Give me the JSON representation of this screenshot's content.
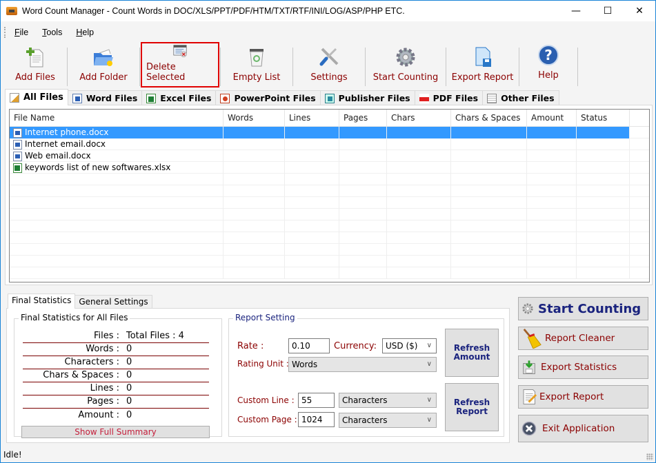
{
  "window": {
    "title": "Word Count Manager - Count Words in DOC/XLS/PPT/PDF/HTM/TXT/RTF/INI/LOG/ASP/PHP ETC.",
    "minimize": "—",
    "maximize": "☐",
    "close": "✕"
  },
  "menu": [
    {
      "accel": "F",
      "rest": "ile"
    },
    {
      "accel": "T",
      "rest": "ools"
    },
    {
      "accel": "H",
      "rest": "elp"
    }
  ],
  "toolbar": [
    {
      "label": "Add Files",
      "icon": "add-files-icon"
    },
    {
      "label": "Add Folder",
      "icon": "add-folder-icon"
    },
    {
      "label": "Delete Selected",
      "icon": "delete-selected-icon",
      "highlighted": true
    },
    {
      "label": "Empty List",
      "icon": "recycle-bin-icon"
    },
    {
      "label": "Settings",
      "icon": "settings-tools-icon"
    },
    {
      "label": "Start Counting",
      "icon": "gear-icon"
    },
    {
      "label": "Export Report",
      "icon": "export-report-icon"
    },
    {
      "label": "Help",
      "icon": "help-icon"
    }
  ],
  "file_tabs": [
    {
      "label": "All Files",
      "active": true
    },
    {
      "label": "Word Files"
    },
    {
      "label": "Excel Files"
    },
    {
      "label": "PowerPoint Files"
    },
    {
      "label": "Publisher Files"
    },
    {
      "label": "PDF Files"
    },
    {
      "label": "Other Files"
    }
  ],
  "table": {
    "columns": [
      "File Name",
      "Words",
      "Lines",
      "Pages",
      "Chars",
      "Chars & Spaces",
      "Amount",
      "Status"
    ],
    "rows": [
      {
        "name": "Internet phone.docx",
        "type": "word",
        "selected": true
      },
      {
        "name": "Internet email.docx",
        "type": "word"
      },
      {
        "name": "Web email.docx",
        "type": "word"
      },
      {
        "name": "keywords list of new softwares.xlsx",
        "type": "excel"
      }
    ]
  },
  "bottom_tabs": [
    {
      "label": "Final Statistics",
      "active": true
    },
    {
      "label": "General Settings"
    }
  ],
  "stats": {
    "group_title": "Final Statistics for All Files",
    "rows": [
      {
        "key": "Files :",
        "value": "Total Files : 4"
      },
      {
        "key": "Words :",
        "value": "0"
      },
      {
        "key": "Characters :",
        "value": "0"
      },
      {
        "key": "Chars & Spaces :",
        "value": "0"
      },
      {
        "key": "Lines :",
        "value": "0"
      },
      {
        "key": "Pages :",
        "value": "0"
      },
      {
        "key": "Amount :",
        "value": "0"
      }
    ],
    "summary_button": "Show Full Summary"
  },
  "report": {
    "group_title": "Report Setting",
    "rate_label": "Rate :",
    "rate_value": "0.10",
    "currency_label": "Currency:",
    "currency_value": "USD ($)",
    "rating_unit_label": "Rating Unit :",
    "rating_unit_value": "Words",
    "custom_line_label": "Custom Line :",
    "custom_line_value": "55",
    "custom_line_unit": "Characters",
    "custom_page_label": "Custom Page :",
    "custom_page_value": "1024",
    "custom_page_unit": "Characters",
    "refresh_amount": [
      "Refresh",
      "Amount"
    ],
    "refresh_report": [
      "Refresh",
      "Report"
    ]
  },
  "side_buttons": [
    {
      "label": "Start Counting",
      "icon": "gear-icon"
    },
    {
      "label": "Report Cleaner",
      "icon": "broom-icon"
    },
    {
      "label": "Export Statistics",
      "icon": "export-statistics-icon"
    },
    {
      "label": "Export Report",
      "icon": "edit-document-icon"
    },
    {
      "label": "Exit Application",
      "icon": "exit-icon"
    }
  ],
  "status": "Idle!",
  "colors": {
    "label_red": "#8b0000",
    "accent_blue": "#1a237e",
    "selection": "#3399ff",
    "highlight_border": "#e00000"
  }
}
